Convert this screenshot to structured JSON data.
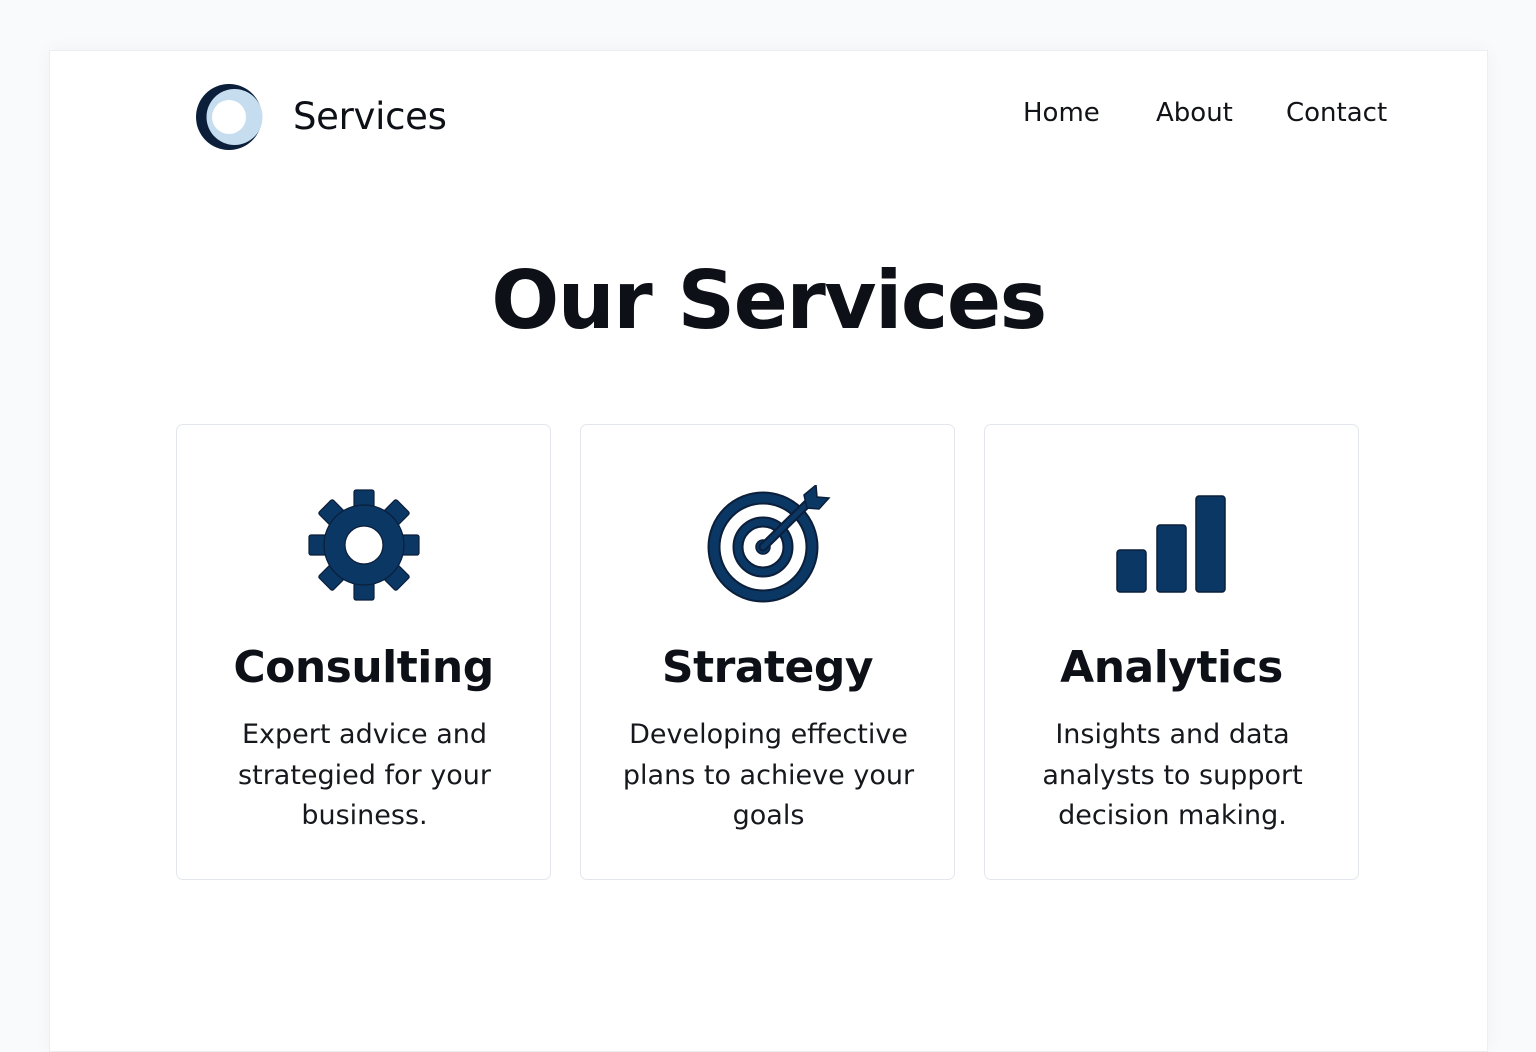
{
  "header": {
    "brand": "Services",
    "nav": [
      {
        "label": "Home"
      },
      {
        "label": "About"
      },
      {
        "label": "Contact"
      }
    ]
  },
  "main": {
    "title": "Our Services",
    "cards": [
      {
        "icon": "gear-icon",
        "title": "Consulting",
        "description": "Expert advice and strategied for your business."
      },
      {
        "icon": "target-icon",
        "title": "Strategy",
        "description": "Developing effective plans to achieve your goals"
      },
      {
        "icon": "bar-chart-icon",
        "title": "Analytics",
        "description": "Insights and data analysts to support decision making."
      }
    ]
  },
  "colors": {
    "icon": "#0b3764",
    "icon_dark": "#0b1e3a",
    "logo_light": "#c5ddef",
    "text": "#0d1016"
  }
}
